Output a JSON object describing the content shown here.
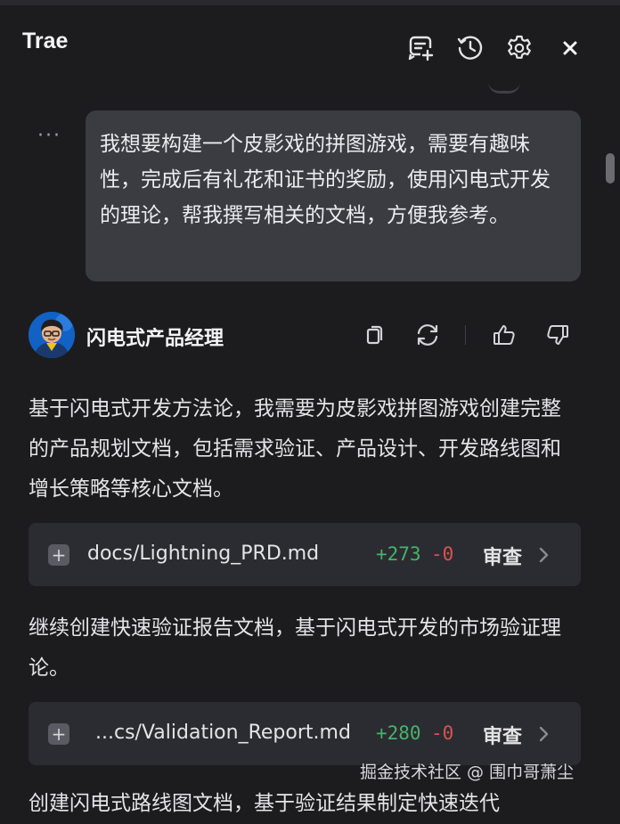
{
  "header": {
    "title": "Trae",
    "icons": [
      "new-chat-icon",
      "history-icon",
      "settings-icon",
      "close-icon"
    ]
  },
  "user_message": {
    "more_label": "···",
    "text": "我想要构建一个皮影戏的拼图游戏，需要有趣味性，完成后有礼花和证书的奖励，使用闪电式开发的理论，帮我撰写相关的文档，方便我参考。"
  },
  "agent": {
    "name": "闪电式产品经理",
    "actions": [
      "copy-icon",
      "regenerate-icon",
      "thumbs-up-icon",
      "thumbs-down-icon"
    ]
  },
  "messages": {
    "p1": "基于闪电式开发方法论，我需要为皮影戏拼图游戏创建完整的产品规划文档，包括需求验证、产品设计、开发路线图和增长策略等核心文档。",
    "p2": "继续创建快速验证报告文档，基于闪电式开发的市场验证理论。",
    "p3": "创建闪电式路线图文档，基于验证结果制定快速迭代"
  },
  "files": [
    {
      "name": "docs/Lightning_PRD.md",
      "added": "+273",
      "removed": "-0",
      "action": "审查"
    },
    {
      "name": "...cs/Validation_Report.md",
      "added": "+280",
      "removed": "-0",
      "action": "审查"
    }
  ],
  "watermark": "掘金技术社区 @ 围巾哥萧尘",
  "colors": {
    "background": "#1c1c1f",
    "bubble": "#3a3c42",
    "card": "#2b2c31",
    "added": "#46b36a",
    "removed": "#d9534f"
  }
}
